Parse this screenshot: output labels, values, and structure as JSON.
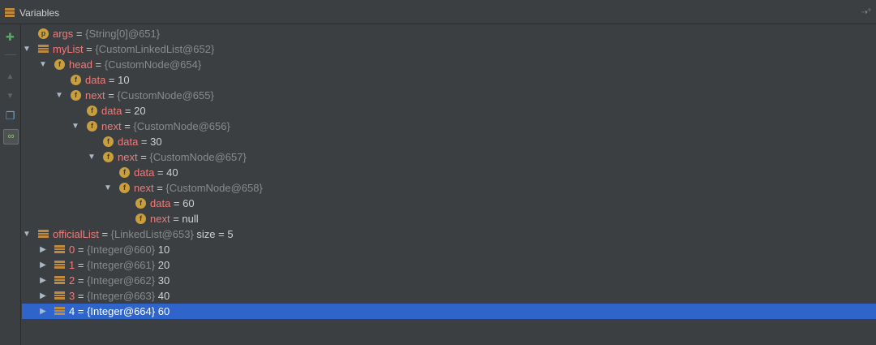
{
  "panel": {
    "title": "Variables",
    "corner_icon": "pin-icon"
  },
  "toolbar": {
    "icons": [
      "new-watch-icon",
      "separator",
      "up-arrow-icon",
      "down-arrow-icon",
      "copy-icon",
      "watches-toggle-icon"
    ]
  },
  "tree": [
    {
      "depth": 0,
      "expand": "none",
      "icon": "p",
      "name": "args",
      "type": "{String[0]@651}",
      "value": ""
    },
    {
      "depth": 0,
      "expand": "open",
      "icon": "list",
      "name": "myList",
      "type": "{CustomLinkedList@652}",
      "value": ""
    },
    {
      "depth": 1,
      "expand": "open",
      "icon": "f",
      "name": "head",
      "type": "{CustomNode@654}",
      "value": ""
    },
    {
      "depth": 2,
      "expand": "none",
      "icon": "f",
      "name": "data",
      "type": "",
      "value": "10"
    },
    {
      "depth": 2,
      "expand": "open",
      "icon": "f",
      "name": "next",
      "type": "{CustomNode@655}",
      "value": ""
    },
    {
      "depth": 3,
      "expand": "none",
      "icon": "f",
      "name": "data",
      "type": "",
      "value": "20"
    },
    {
      "depth": 3,
      "expand": "open",
      "icon": "f",
      "name": "next",
      "type": "{CustomNode@656}",
      "value": ""
    },
    {
      "depth": 4,
      "expand": "none",
      "icon": "f",
      "name": "data",
      "type": "",
      "value": "30"
    },
    {
      "depth": 4,
      "expand": "open",
      "icon": "f",
      "name": "next",
      "type": "{CustomNode@657}",
      "value": ""
    },
    {
      "depth": 5,
      "expand": "none",
      "icon": "f",
      "name": "data",
      "type": "",
      "value": "40"
    },
    {
      "depth": 5,
      "expand": "open",
      "icon": "f",
      "name": "next",
      "type": "{CustomNode@658}",
      "value": ""
    },
    {
      "depth": 6,
      "expand": "none",
      "icon": "f",
      "name": "data",
      "type": "",
      "value": "60"
    },
    {
      "depth": 6,
      "expand": "none",
      "icon": "f",
      "name": "next",
      "type": "",
      "value": "null"
    },
    {
      "depth": 0,
      "expand": "open",
      "icon": "list",
      "name": "officialList",
      "type": "{LinkedList@653}",
      "value": " size = 5"
    },
    {
      "depth": 1,
      "expand": "closed",
      "icon": "list",
      "name": "0",
      "type": "{Integer@660}",
      "value": "10"
    },
    {
      "depth": 1,
      "expand": "closed",
      "icon": "list",
      "name": "1",
      "type": "{Integer@661}",
      "value": "20"
    },
    {
      "depth": 1,
      "expand": "closed",
      "icon": "list",
      "name": "2",
      "type": "{Integer@662}",
      "value": "30"
    },
    {
      "depth": 1,
      "expand": "closed",
      "icon": "list",
      "name": "3",
      "type": "{Integer@663}",
      "value": "40"
    },
    {
      "depth": 1,
      "expand": "closed",
      "icon": "list",
      "name": "4",
      "type": "{Integer@664}",
      "value": "60",
      "selected": true
    }
  ],
  "colors": {
    "background": "#3c3f41",
    "selection": "#2f65ca",
    "name": "#f07a7a",
    "type": "#868b8e",
    "value": "#cfcfcf",
    "field_icon": "#c99f3e"
  }
}
